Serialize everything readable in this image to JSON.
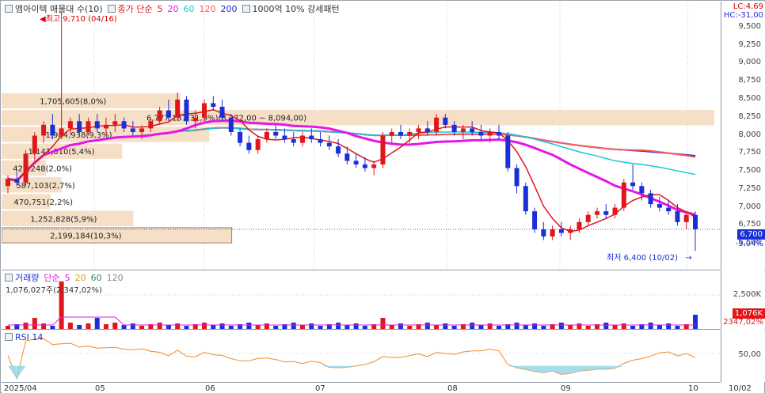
{
  "price_legend": {
    "stock_name": "엠아이텍 매물대 수(10)",
    "ma_prefix": "종가 단순",
    "ma_periods": [
      "5",
      "20",
      "60",
      "120",
      "200"
    ],
    "ma_colors": [
      "#e0161b",
      "#e417e8",
      "#14c7d9",
      "#ff5a5a",
      "#1a2fd6"
    ],
    "extra": "1000억 10% 강세패턴"
  },
  "top_right": {
    "lc": "LC:4,69",
    "hc": "HC:-31,00"
  },
  "price_axis": {
    "ticks": [
      "9,500",
      "9,250",
      "9,000",
      "8,750",
      "8,500",
      "8,250",
      "8,000",
      "7,750",
      "7,500",
      "7,250",
      "7,000",
      "6,750",
      "6,500"
    ],
    "last_price": "6,700",
    "last_change": "-3,04%"
  },
  "annotations": {
    "high": "최고 9,710 (04/16)",
    "low": "최저 6,400 (10/02)"
  },
  "volume_profile": [
    {
      "label": "2,199,184(10,3%)",
      "share": 10.3
    },
    {
      "label": "1,252,828(5,9%)",
      "share": 5.9
    },
    {
      "label": "470,751(2,2%)",
      "share": 2.2
    },
    {
      "label": "587,103(2,7%)",
      "share": 2.7
    },
    {
      "label": "429,248(2,0%)",
      "share": 2.0
    },
    {
      "label": "1,147,010(5,4%)",
      "share": 5.4
    },
    {
      "label": "1,984,938(9,3%)",
      "share": 9.3
    },
    {
      "label": "6,777,187(31,9%)(8,272,00 ~ 8,094,00)",
      "share": 31.9
    },
    {
      "label": "1,705,605(8,0%)",
      "share": 8.0
    }
  ],
  "volume_legend": {
    "title": "거래량",
    "ma_prefix": "단순",
    "ma_periods": [
      "5",
      "20",
      "60",
      "120"
    ],
    "ma_colors": [
      "#e417e8",
      "#d4a017",
      "#2e8b57",
      "#888888"
    ],
    "last_value": "1,076,027주(2,347,02%)"
  },
  "volume_axis": {
    "tick": "2,500K",
    "last_value": "1,076K",
    "last_pct": "2347,02%"
  },
  "rsi_legend": {
    "title": "RSI 14"
  },
  "rsi_axis": {
    "tick": "50,00"
  },
  "x_axis": {
    "labels": [
      "2025/04",
      "05",
      "06",
      "07",
      "08",
      "09",
      "10",
      "10/02"
    ]
  },
  "chart_data": {
    "type": "candlestick",
    "price_range": [
      6500,
      9500
    ],
    "ohlc": [
      [
        7300,
        7450,
        7200,
        7400
      ],
      [
        7400,
        7500,
        7300,
        7350
      ],
      [
        7350,
        7800,
        7300,
        7750
      ],
      [
        7750,
        8050,
        7650,
        8000
      ],
      [
        8000,
        8200,
        7900,
        8150
      ],
      [
        8150,
        8300,
        7950,
        8000
      ],
      [
        8000,
        9710,
        7950,
        8100
      ],
      [
        8100,
        8250,
        8000,
        8200
      ],
      [
        8200,
        8300,
        8000,
        8050
      ],
      [
        8050,
        8250,
        8000,
        8200
      ],
      [
        8200,
        8300,
        8050,
        8100
      ],
      [
        8100,
        8250,
        8000,
        8150
      ],
      [
        8150,
        8300,
        8050,
        8200
      ],
      [
        8200,
        8250,
        8050,
        8100
      ],
      [
        8100,
        8200,
        8000,
        8050
      ],
      [
        8050,
        8150,
        7950,
        8100
      ],
      [
        8100,
        8250,
        8050,
        8200
      ],
      [
        8200,
        8400,
        8150,
        8350
      ],
      [
        8350,
        8500,
        8200,
        8250
      ],
      [
        8250,
        8600,
        8200,
        8500
      ],
      [
        8500,
        8550,
        8150,
        8200
      ],
      [
        8200,
        8350,
        8100,
        8250
      ],
      [
        8250,
        8500,
        8200,
        8450
      ],
      [
        8450,
        8550,
        8350,
        8400
      ],
      [
        8400,
        8500,
        8200,
        8250
      ],
      [
        8250,
        8300,
        8000,
        8050
      ],
      [
        8050,
        8100,
        7850,
        7900
      ],
      [
        7900,
        8000,
        7750,
        7800
      ],
      [
        7800,
        8000,
        7750,
        7950
      ],
      [
        7950,
        8100,
        7900,
        8050
      ],
      [
        8050,
        8150,
        7950,
        8000
      ],
      [
        8000,
        8100,
        7900,
        7950
      ],
      [
        7950,
        8050,
        7850,
        7900
      ],
      [
        7900,
        8050,
        7850,
        8000
      ],
      [
        8000,
        8100,
        7900,
        7950
      ],
      [
        7950,
        8050,
        7850,
        7900
      ],
      [
        7900,
        8000,
        7800,
        7850
      ],
      [
        7850,
        7950,
        7700,
        7750
      ],
      [
        7750,
        7850,
        7600,
        7650
      ],
      [
        7650,
        7750,
        7550,
        7600
      ],
      [
        7600,
        7700,
        7500,
        7550
      ],
      [
        7550,
        7650,
        7450,
        7600
      ],
      [
        7600,
        8050,
        7550,
        8000
      ],
      [
        8000,
        8100,
        7900,
        8050
      ],
      [
        8050,
        8150,
        7950,
        8000
      ],
      [
        8000,
        8100,
        7900,
        8050
      ],
      [
        8050,
        8150,
        7950,
        8100
      ],
      [
        8100,
        8200,
        8000,
        8050
      ],
      [
        8050,
        8300,
        8000,
        8250
      ],
      [
        8250,
        8300,
        8100,
        8150
      ],
      [
        8150,
        8200,
        8000,
        8050
      ],
      [
        8050,
        8150,
        7950,
        8100
      ],
      [
        8100,
        8200,
        8000,
        8050
      ],
      [
        8050,
        8150,
        7950,
        8000
      ],
      [
        8000,
        8100,
        7900,
        8050
      ],
      [
        8050,
        8150,
        7950,
        8000
      ],
      [
        8000,
        8050,
        7500,
        7550
      ],
      [
        7550,
        7600,
        7200,
        7300
      ],
      [
        7300,
        7350,
        6900,
        6950
      ],
      [
        6950,
        7000,
        6650,
        6700
      ],
      [
        6700,
        6800,
        6550,
        6600
      ],
      [
        6600,
        6750,
        6550,
        6700
      ],
      [
        6700,
        6800,
        6600,
        6650
      ],
      [
        6650,
        6750,
        6550,
        6700
      ],
      [
        6700,
        6850,
        6650,
        6800
      ],
      [
        6800,
        6950,
        6750,
        6900
      ],
      [
        6900,
        7000,
        6850,
        6950
      ],
      [
        6950,
        7050,
        6850,
        6900
      ],
      [
        6900,
        7050,
        6850,
        7000
      ],
      [
        7000,
        7400,
        6950,
        7350
      ],
      [
        7350,
        7600,
        7250,
        7300
      ],
      [
        7300,
        7350,
        7100,
        7200
      ],
      [
        7200,
        7250,
        7000,
        7050
      ],
      [
        7050,
        7150,
        6950,
        7000
      ],
      [
        7000,
        7100,
        6900,
        6950
      ],
      [
        6950,
        7050,
        6750,
        6800
      ],
      [
        6800,
        6950,
        6700,
        6900
      ],
      [
        6900,
        6950,
        6400,
        6700
      ]
    ]
  }
}
